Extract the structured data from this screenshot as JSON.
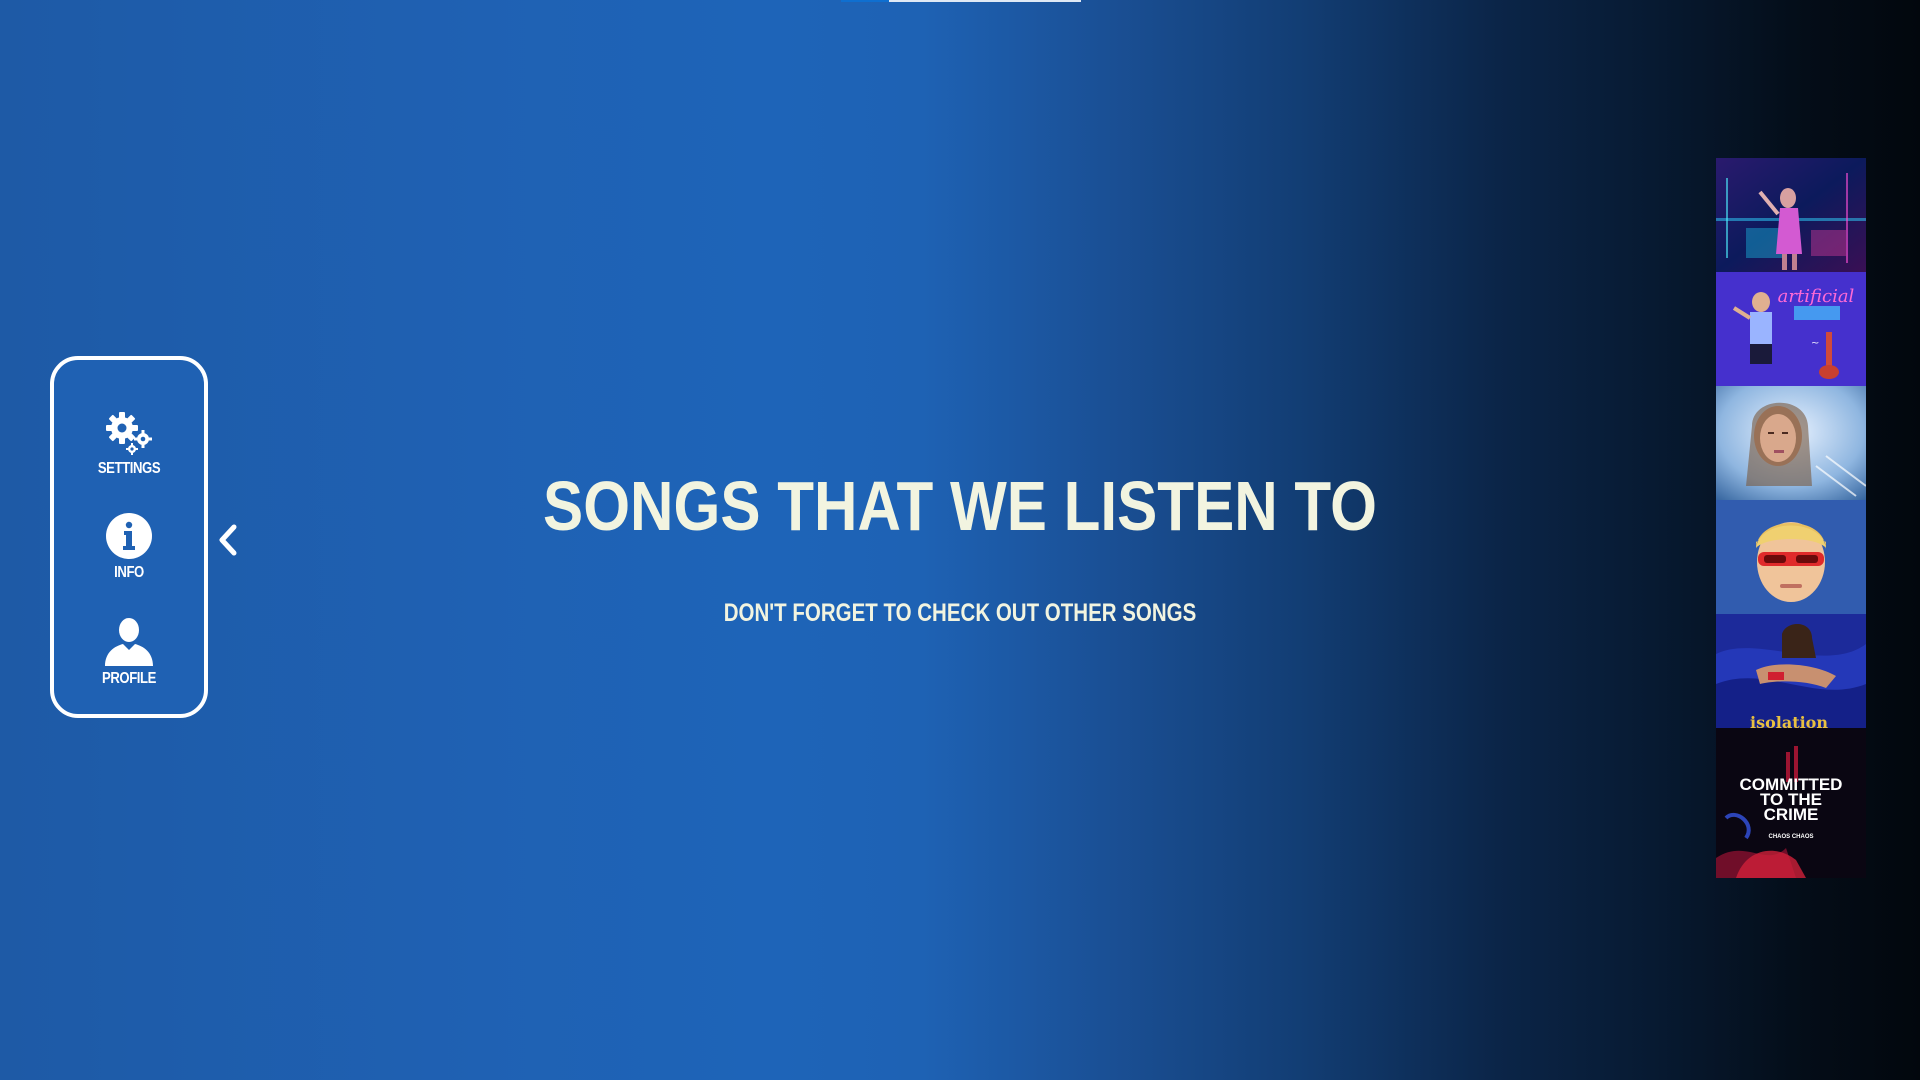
{
  "top_progress": {
    "fraction": 0.8
  },
  "sidebar": {
    "items": [
      {
        "label": "SETTINGS",
        "icon": "gears-icon"
      },
      {
        "label": "INFO",
        "icon": "info-icon"
      },
      {
        "label": "PROFILE",
        "icon": "user-icon"
      }
    ],
    "collapse_icon": "chevron-left-icon"
  },
  "hero": {
    "title": "SONGS THAT WE LISTEN TO",
    "subtitle": "DON'T FORGET TO CHECK OUT OTHER SONGS"
  },
  "covers": [
    {
      "name": "cover-1",
      "lettering": ""
    },
    {
      "name": "cover-2",
      "lettering": "artificial"
    },
    {
      "name": "cover-3",
      "lettering": ""
    },
    {
      "name": "cover-4",
      "lettering": ""
    },
    {
      "name": "cover-5",
      "lettering": "isolation"
    },
    {
      "name": "cover-6",
      "lettering": "COMMITTED TO THE CRIME",
      "sub_lettering": "CHAOS CHAOS"
    }
  ],
  "colors": {
    "text_cream": "#f2f4e0",
    "panel_blue": "#1f61b3",
    "white": "#ffffff"
  }
}
